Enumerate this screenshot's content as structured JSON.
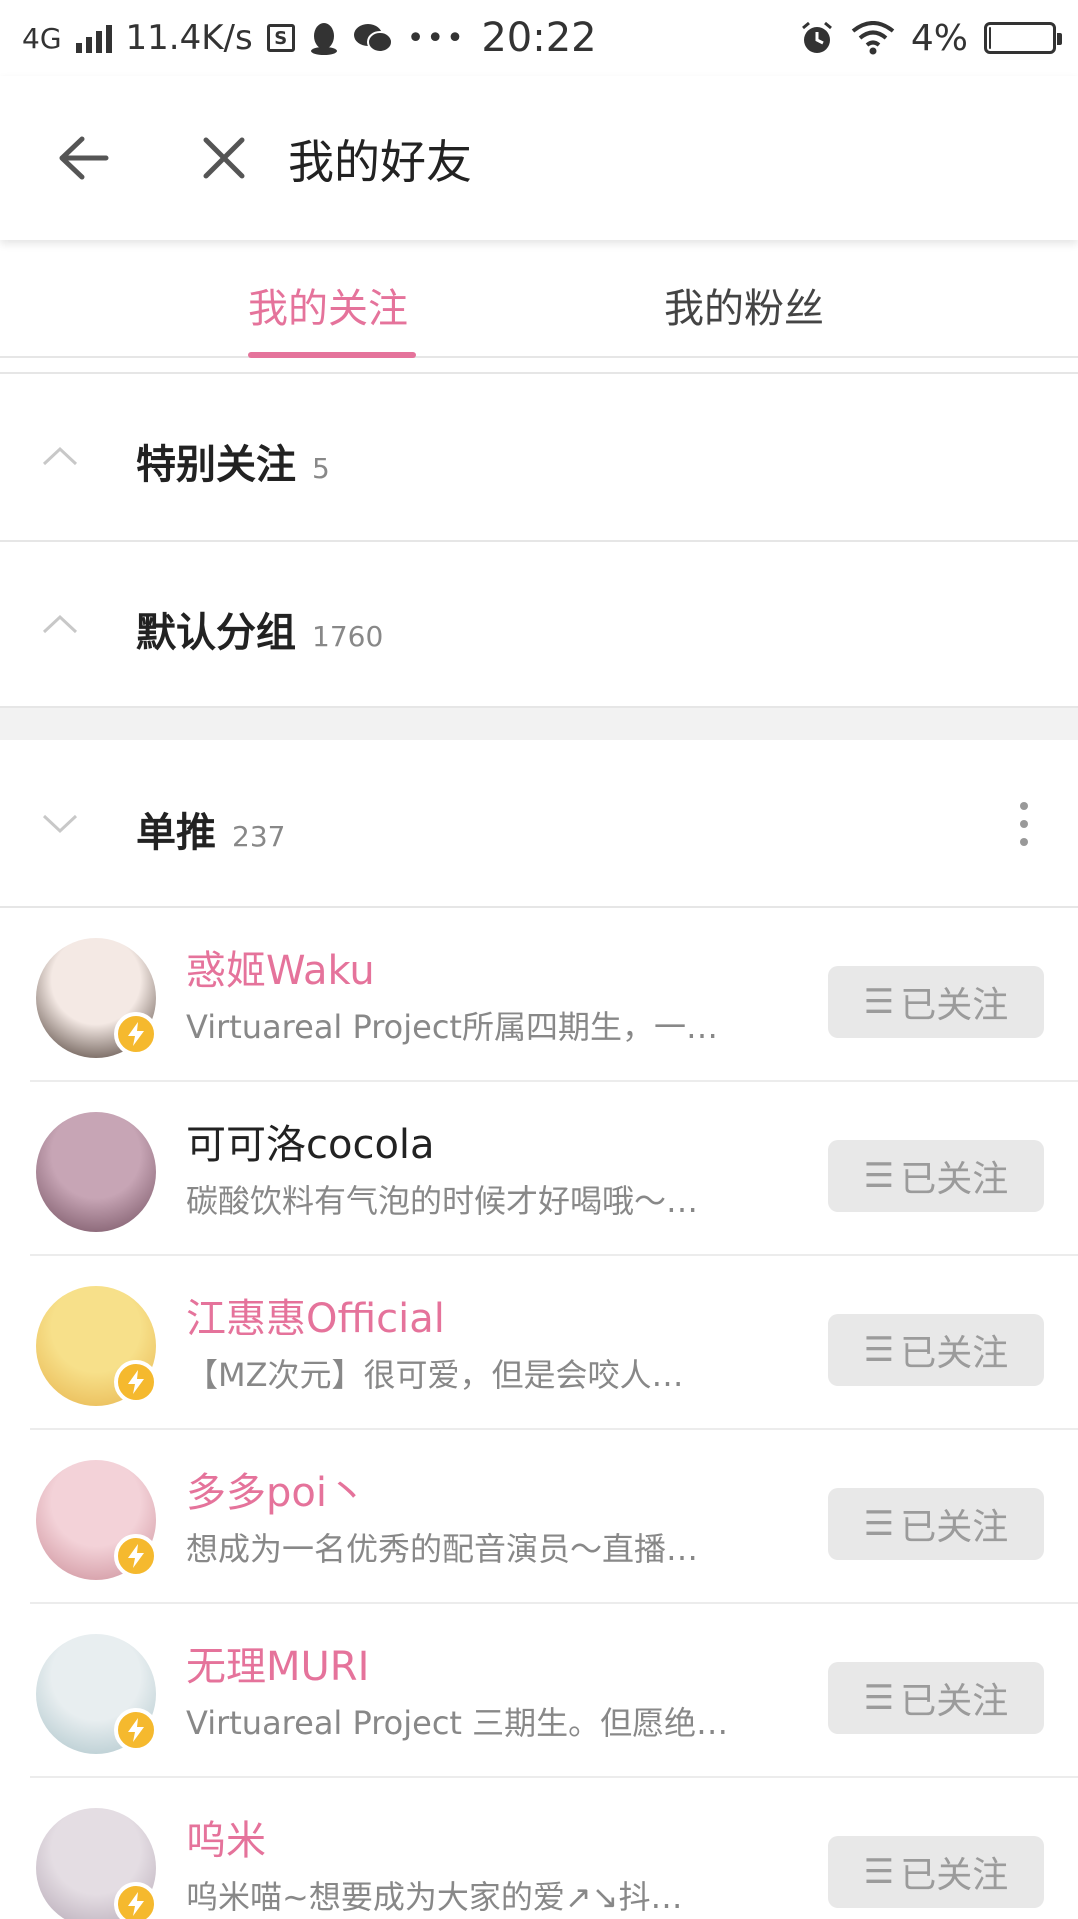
{
  "status_bar": {
    "network": "4G",
    "speed": "11.4K/s",
    "time": "20:22",
    "battery": "4%",
    "battery_level": 0.04
  },
  "app_bar": {
    "title": "我的好友"
  },
  "tabs": [
    {
      "label": "我的关注",
      "active": true
    },
    {
      "label": "我的粉丝",
      "active": false
    }
  ],
  "groups": [
    {
      "name": "特别关注",
      "count": "5",
      "expanded": false
    },
    {
      "name": "默认分组",
      "count": "1760",
      "expanded": false
    },
    {
      "name": "单推",
      "count": "237",
      "expanded": true
    }
  ],
  "follow_label": "已关注",
  "users": [
    {
      "name": "惑姬Waku",
      "desc": "Virtuareal Project所属四期生，一…",
      "highlight": true,
      "verified": true,
      "avatar_colors": [
        "#f4e9e4",
        "#3a2a22"
      ]
    },
    {
      "name": "可可洛cocola",
      "desc": "碳酸饮料有气泡的时候才好喝哦～…",
      "highlight": false,
      "verified": false,
      "avatar_colors": [
        "#c7a5b5",
        "#6d4a5a"
      ]
    },
    {
      "name": "江惠惠Official",
      "desc": "【MZ次元】很可爱，但是会咬人…",
      "highlight": true,
      "verified": true,
      "avatar_colors": [
        "#f7e08a",
        "#e6b24a"
      ]
    },
    {
      "name": "多多poi丶",
      "desc": "想成为一名优秀的配音演员～直播…",
      "highlight": true,
      "verified": true,
      "avatar_colors": [
        "#f3d2d8",
        "#c98a95"
      ]
    },
    {
      "name": "无理MURI",
      "desc": "Virtuareal Project 三期生。但愿绝…",
      "highlight": true,
      "verified": true,
      "avatar_colors": [
        "#e8eef0",
        "#a9c2c8"
      ]
    },
    {
      "name": "呜米",
      "desc": "呜米喵~想要成为大家的爱↗↘抖…",
      "highlight": true,
      "verified": true,
      "avatar_colors": [
        "#e4dde3",
        "#b0a2b0"
      ]
    }
  ],
  "colors": {
    "accent": "#e5739b",
    "badge": "#f5b92e",
    "button_bg": "#e8e8e8"
  }
}
